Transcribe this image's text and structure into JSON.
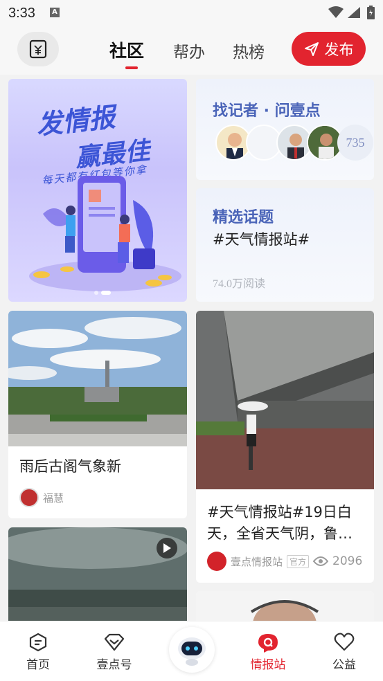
{
  "status": {
    "time": "3:33"
  },
  "header": {
    "tabs": [
      {
        "label": "社区",
        "active": true
      },
      {
        "label": "帮办",
        "active": false
      },
      {
        "label": "热榜",
        "active": false
      }
    ],
    "publish_label": "发布"
  },
  "banner": {
    "line1": "发情报",
    "line2": "赢最佳",
    "line3": "每天都有红包等你拿"
  },
  "reporter_card": {
    "title": "找记者 · 问壹点",
    "count": "735"
  },
  "topic_card": {
    "title": "精选话题",
    "tag": "#天气情报站#",
    "reads": "74.0万阅读"
  },
  "posts": [
    {
      "title": "雨后古阁气象新",
      "author": "福慧"
    },
    {
      "title": "#天气情报站#19日白天，全省天气阴，鲁…",
      "author": "壹点情报站",
      "badge": "官方",
      "views": "2096"
    }
  ],
  "nav": {
    "items": [
      {
        "label": "首页",
        "icon": "home-icon"
      },
      {
        "label": "壹点号",
        "icon": "diamond-icon"
      },
      {
        "label": "情报站",
        "icon": "intel-icon",
        "active": true
      },
      {
        "label": "公益",
        "icon": "heart-icon"
      }
    ]
  },
  "colors": {
    "accent": "#e2242f",
    "title_blue": "#4a64b8"
  }
}
